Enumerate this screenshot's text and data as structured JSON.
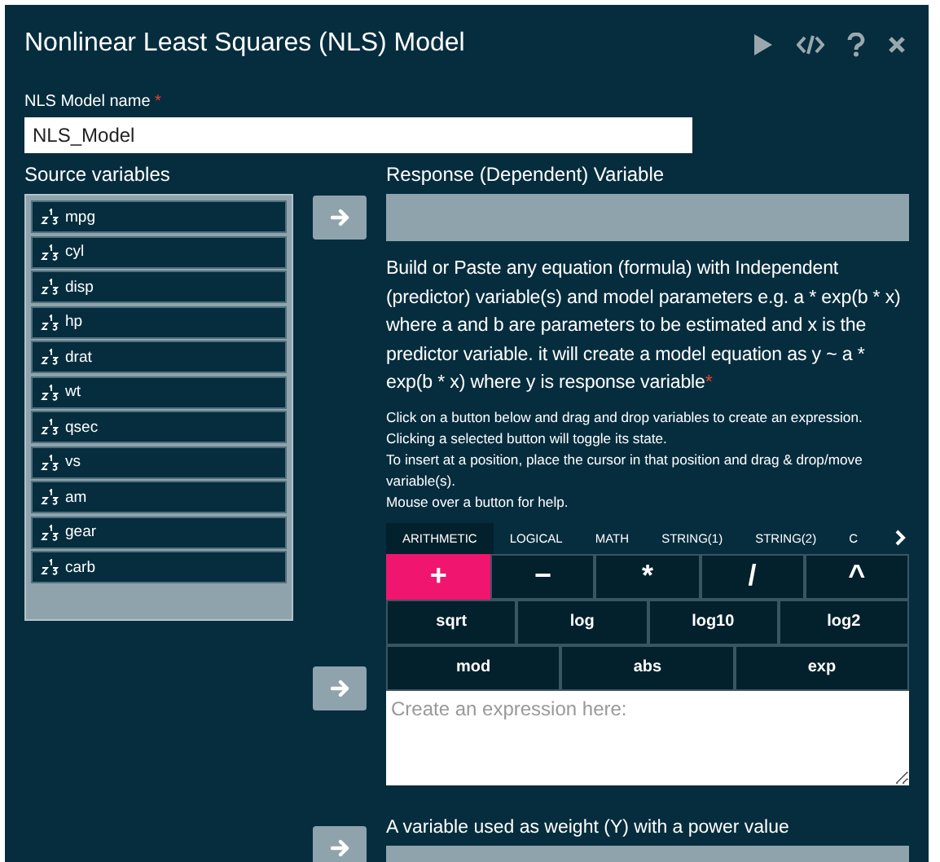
{
  "window": {
    "title": "Nonlinear Least Squares (NLS) Model"
  },
  "model_name": {
    "label": "NLS Model name",
    "required": true,
    "value": "NLS_Model"
  },
  "source_variables": {
    "label": "Source variables",
    "items": [
      {
        "name": "mpg"
      },
      {
        "name": "cyl"
      },
      {
        "name": "disp"
      },
      {
        "name": "hp"
      },
      {
        "name": "drat"
      },
      {
        "name": "wt"
      },
      {
        "name": "qsec"
      },
      {
        "name": "vs"
      },
      {
        "name": "am"
      },
      {
        "name": "gear"
      },
      {
        "name": "carb"
      }
    ]
  },
  "response": {
    "label": "Response (Dependent) Variable"
  },
  "formula": {
    "description": "Build or Paste any equation (formula) with Independent (predictor) variable(s) and model parameters e.g. a * exp(b * x) where a and b are parameters to be estimated and x is the predictor variable. it will create a model equation as y ~ a * exp(b * x) where y is response variable",
    "required": true,
    "help": [
      "Click on a button below and drag and drop variables to create an expression.",
      "Clicking a selected button will toggle its state.",
      "To insert at a position, place the cursor in that position and drag & drop/move variable(s).",
      "Mouse over a button for help."
    ],
    "tabs": [
      {
        "label": "ARITHMETIC",
        "selected": true
      },
      {
        "label": "LOGICAL",
        "selected": false
      },
      {
        "label": "MATH",
        "selected": false
      },
      {
        "label": "STRING(1)",
        "selected": false
      },
      {
        "label": "STRING(2)",
        "selected": false
      },
      {
        "label": "C",
        "selected": false
      }
    ],
    "button_rows": [
      [
        {
          "label": "+",
          "selected": true
        },
        {
          "label": "−",
          "selected": false
        },
        {
          "label": "*",
          "selected": false
        },
        {
          "label": "/",
          "selected": false
        },
        {
          "label": "^",
          "selected": false
        }
      ],
      [
        {
          "label": "sqrt",
          "selected": false
        },
        {
          "label": "log",
          "selected": false
        },
        {
          "label": "log10",
          "selected": false
        },
        {
          "label": "log2",
          "selected": false
        }
      ],
      [
        {
          "label": "mod",
          "selected": false
        },
        {
          "label": "abs",
          "selected": false
        },
        {
          "label": "exp",
          "selected": false
        }
      ]
    ],
    "expression": {
      "placeholder": "Create an expression here:"
    }
  },
  "weight": {
    "label": "A variable used as weight (Y) with a power value"
  }
}
